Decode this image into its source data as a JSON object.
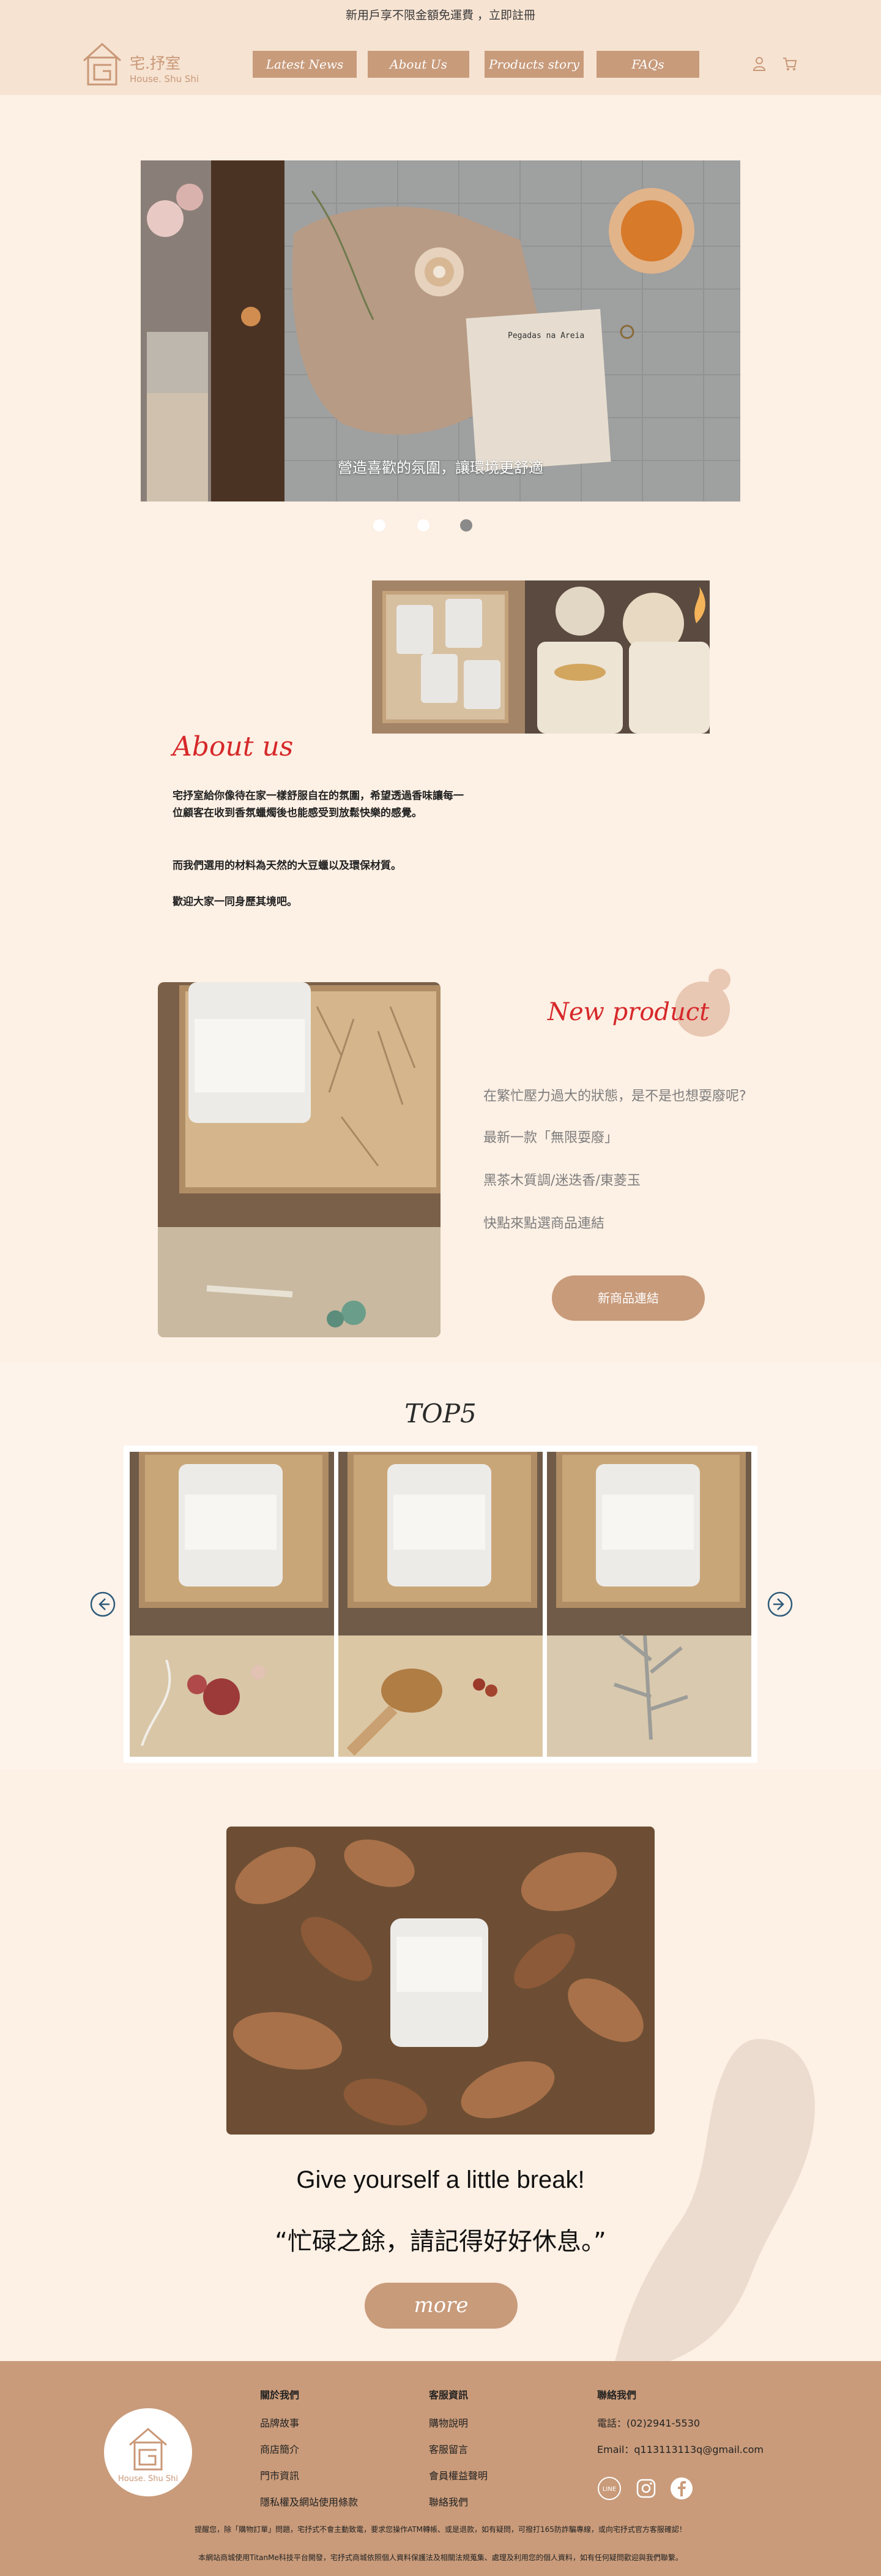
{
  "announcement": "新用戶享不限金額免運費 ，立即註冊",
  "brand": {
    "name": "宅.抒室",
    "sub": "House. Shu Shi",
    "footer_sub": "House. Shu Shi"
  },
  "nav": [
    {
      "label": "Latest News"
    },
    {
      "label": "About Us"
    },
    {
      "label": "Products story"
    },
    {
      "label": "FAQs"
    }
  ],
  "hero": {
    "caption": "營造喜歡的氛圍，讓環境更舒適",
    "slides": 3,
    "active_slide": 3,
    "paper_text": "Pegadas na Areia"
  },
  "about": {
    "title": "About us",
    "p1": "宅抒室給你像待在家一樣舒服自在的氛圍，希望透過香味讓每一位顧客在收到香氛蠟燭後也能感受到放鬆快樂的感覺。",
    "p2": "而我們選用的材料為天然的大豆蠟以及環保材質。",
    "p3": "歡迎大家一同身歷其境吧。"
  },
  "new_product": {
    "title": "New product",
    "lines": [
      "在繁忙壓力過大的狀態，是不是也想耍廢呢?",
      "最新一款「無限耍廢」",
      "黑茶木質調/迷迭香/東菱玉",
      "快點來點選商品連結"
    ],
    "button": "新商品連結"
  },
  "top5": {
    "title": "TOP5",
    "prev_icon": "arrow-left-circle-icon",
    "next_icon": "arrow-right-circle-icon"
  },
  "break": {
    "title": "Give yourself a little break!",
    "quote": "“忙碌之餘，請記得好好休息。”",
    "button": "more"
  },
  "footer": {
    "col1": {
      "heading": "關於我們",
      "items": [
        "品牌故事",
        "商店簡介",
        "門市資訊",
        "隱私權及網站使用條款"
      ]
    },
    "col2": {
      "heading": "客服資訊",
      "items": [
        "購物說明",
        "客服留言",
        "會員權益聲明",
        "聯絡我們"
      ]
    },
    "col3": {
      "heading": "聯絡我們",
      "phone": "電話：(02)2941-5530",
      "email": "Email：q113113113q@gmail.com"
    },
    "social": [
      "line-icon",
      "instagram-icon",
      "facebook-icon"
    ],
    "social_label": "LINE",
    "notice1": "提醒您，除「購物訂單」問題，宅抒式不會主動致電，要求您操作ATM轉帳、或是退款，如有疑問，可撥打165防詐騙專線，或向宅抒式官方客服確認！",
    "notice2": "本網站商城使用TitanMe科技平台開發，宅抒式商城依照個人資料保護法及相關法規蒐集、處理及利用您的個人資料，如有任何疑問歡迎與我們聯繫。"
  },
  "colors": {
    "accent": "#c89b7b",
    "bg": "#fdf0e4",
    "header": "#f6e3d2",
    "red_title": "#d6282a"
  }
}
